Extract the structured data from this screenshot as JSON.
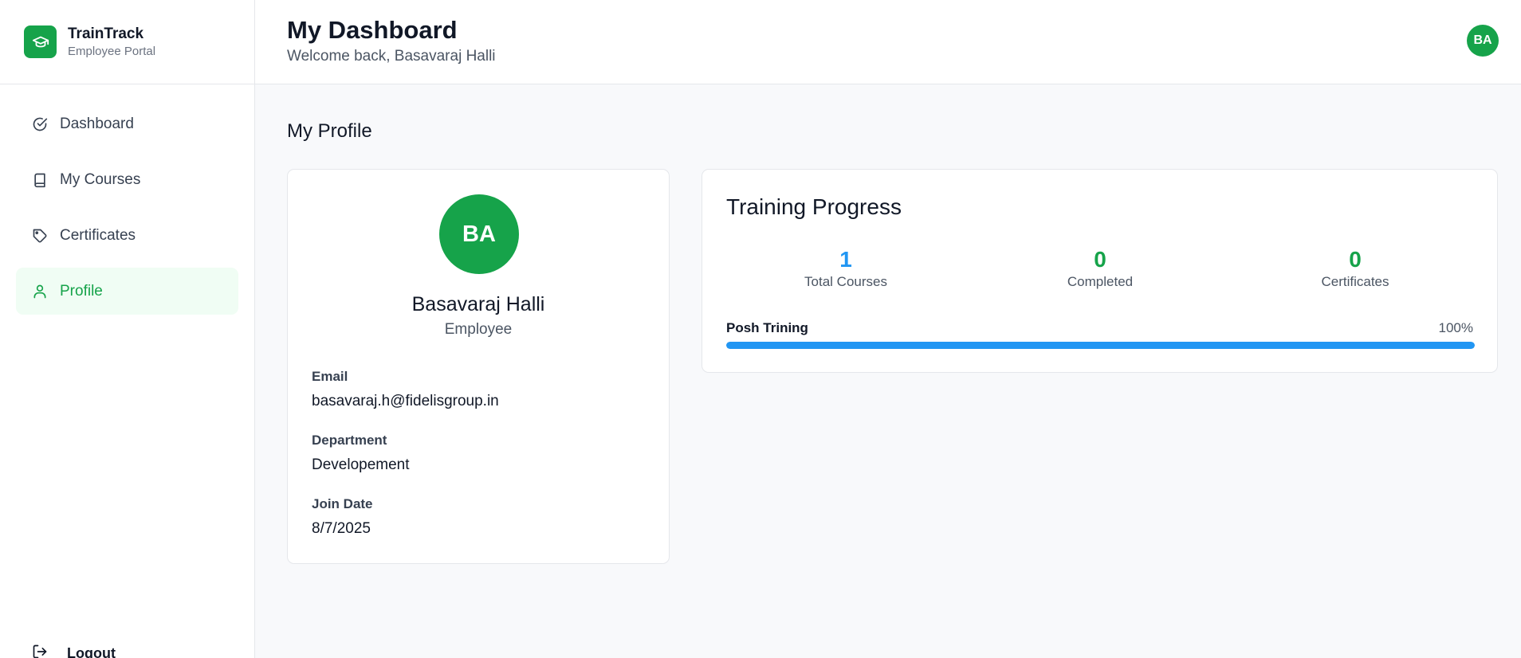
{
  "app": {
    "name": "TrainTrack",
    "subtitle": "Employee Portal",
    "brand_color": "#16a34a"
  },
  "sidebar": {
    "items": [
      {
        "label": "Dashboard",
        "icon": "check-circle-icon",
        "active": false
      },
      {
        "label": "My Courses",
        "icon": "book-icon",
        "active": false
      },
      {
        "label": "Certificates",
        "icon": "tag-icon",
        "active": false
      },
      {
        "label": "Profile",
        "icon": "user-icon",
        "active": true
      }
    ],
    "logout_label": "Logout"
  },
  "header": {
    "title": "My Dashboard",
    "welcome": "Welcome back, Basavaraj Halli",
    "avatar_initials": "BA"
  },
  "profile": {
    "section_title": "My Profile",
    "initials": "BA",
    "name": "Basavaraj Halli",
    "role": "Employee",
    "fields": [
      {
        "label": "Email",
        "value": "basavaraj.h@fidelisgroup.in"
      },
      {
        "label": "Department",
        "value": "Developement"
      },
      {
        "label": "Join Date",
        "value": "8/7/2025"
      }
    ]
  },
  "training_progress": {
    "title": "Training Progress",
    "stats": [
      {
        "value": "1",
        "label": "Total Courses",
        "color": "#2196f3"
      },
      {
        "value": "0",
        "label": "Completed",
        "color": "#16a34a"
      },
      {
        "value": "0",
        "label": "Certificates",
        "color": "#16a34a"
      }
    ],
    "courses": [
      {
        "name": "Posh Trining",
        "percent_label": "100%",
        "progress": 1.0,
        "bar_color": "#2196f3"
      }
    ]
  }
}
